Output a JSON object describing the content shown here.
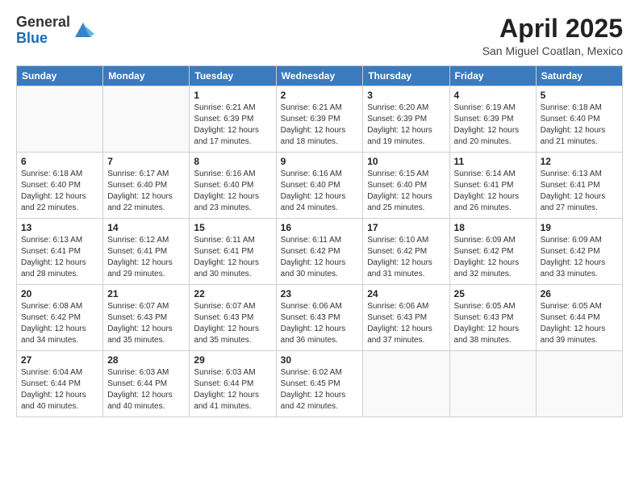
{
  "logo": {
    "general": "General",
    "blue": "Blue"
  },
  "title": "April 2025",
  "location": "San Miguel Coatlan, Mexico",
  "days_of_week": [
    "Sunday",
    "Monday",
    "Tuesday",
    "Wednesday",
    "Thursday",
    "Friday",
    "Saturday"
  ],
  "weeks": [
    [
      {
        "day": "",
        "info": ""
      },
      {
        "day": "",
        "info": ""
      },
      {
        "day": "1",
        "info": "Sunrise: 6:21 AM\nSunset: 6:39 PM\nDaylight: 12 hours and 17 minutes."
      },
      {
        "day": "2",
        "info": "Sunrise: 6:21 AM\nSunset: 6:39 PM\nDaylight: 12 hours and 18 minutes."
      },
      {
        "day": "3",
        "info": "Sunrise: 6:20 AM\nSunset: 6:39 PM\nDaylight: 12 hours and 19 minutes."
      },
      {
        "day": "4",
        "info": "Sunrise: 6:19 AM\nSunset: 6:39 PM\nDaylight: 12 hours and 20 minutes."
      },
      {
        "day": "5",
        "info": "Sunrise: 6:18 AM\nSunset: 6:40 PM\nDaylight: 12 hours and 21 minutes."
      }
    ],
    [
      {
        "day": "6",
        "info": "Sunrise: 6:18 AM\nSunset: 6:40 PM\nDaylight: 12 hours and 22 minutes."
      },
      {
        "day": "7",
        "info": "Sunrise: 6:17 AM\nSunset: 6:40 PM\nDaylight: 12 hours and 22 minutes."
      },
      {
        "day": "8",
        "info": "Sunrise: 6:16 AM\nSunset: 6:40 PM\nDaylight: 12 hours and 23 minutes."
      },
      {
        "day": "9",
        "info": "Sunrise: 6:16 AM\nSunset: 6:40 PM\nDaylight: 12 hours and 24 minutes."
      },
      {
        "day": "10",
        "info": "Sunrise: 6:15 AM\nSunset: 6:40 PM\nDaylight: 12 hours and 25 minutes."
      },
      {
        "day": "11",
        "info": "Sunrise: 6:14 AM\nSunset: 6:41 PM\nDaylight: 12 hours and 26 minutes."
      },
      {
        "day": "12",
        "info": "Sunrise: 6:13 AM\nSunset: 6:41 PM\nDaylight: 12 hours and 27 minutes."
      }
    ],
    [
      {
        "day": "13",
        "info": "Sunrise: 6:13 AM\nSunset: 6:41 PM\nDaylight: 12 hours and 28 minutes."
      },
      {
        "day": "14",
        "info": "Sunrise: 6:12 AM\nSunset: 6:41 PM\nDaylight: 12 hours and 29 minutes."
      },
      {
        "day": "15",
        "info": "Sunrise: 6:11 AM\nSunset: 6:41 PM\nDaylight: 12 hours and 30 minutes."
      },
      {
        "day": "16",
        "info": "Sunrise: 6:11 AM\nSunset: 6:42 PM\nDaylight: 12 hours and 30 minutes."
      },
      {
        "day": "17",
        "info": "Sunrise: 6:10 AM\nSunset: 6:42 PM\nDaylight: 12 hours and 31 minutes."
      },
      {
        "day": "18",
        "info": "Sunrise: 6:09 AM\nSunset: 6:42 PM\nDaylight: 12 hours and 32 minutes."
      },
      {
        "day": "19",
        "info": "Sunrise: 6:09 AM\nSunset: 6:42 PM\nDaylight: 12 hours and 33 minutes."
      }
    ],
    [
      {
        "day": "20",
        "info": "Sunrise: 6:08 AM\nSunset: 6:42 PM\nDaylight: 12 hours and 34 minutes."
      },
      {
        "day": "21",
        "info": "Sunrise: 6:07 AM\nSunset: 6:43 PM\nDaylight: 12 hours and 35 minutes."
      },
      {
        "day": "22",
        "info": "Sunrise: 6:07 AM\nSunset: 6:43 PM\nDaylight: 12 hours and 35 minutes."
      },
      {
        "day": "23",
        "info": "Sunrise: 6:06 AM\nSunset: 6:43 PM\nDaylight: 12 hours and 36 minutes."
      },
      {
        "day": "24",
        "info": "Sunrise: 6:06 AM\nSunset: 6:43 PM\nDaylight: 12 hours and 37 minutes."
      },
      {
        "day": "25",
        "info": "Sunrise: 6:05 AM\nSunset: 6:43 PM\nDaylight: 12 hours and 38 minutes."
      },
      {
        "day": "26",
        "info": "Sunrise: 6:05 AM\nSunset: 6:44 PM\nDaylight: 12 hours and 39 minutes."
      }
    ],
    [
      {
        "day": "27",
        "info": "Sunrise: 6:04 AM\nSunset: 6:44 PM\nDaylight: 12 hours and 40 minutes."
      },
      {
        "day": "28",
        "info": "Sunrise: 6:03 AM\nSunset: 6:44 PM\nDaylight: 12 hours and 40 minutes."
      },
      {
        "day": "29",
        "info": "Sunrise: 6:03 AM\nSunset: 6:44 PM\nDaylight: 12 hours and 41 minutes."
      },
      {
        "day": "30",
        "info": "Sunrise: 6:02 AM\nSunset: 6:45 PM\nDaylight: 12 hours and 42 minutes."
      },
      {
        "day": "",
        "info": ""
      },
      {
        "day": "",
        "info": ""
      },
      {
        "day": "",
        "info": ""
      }
    ]
  ]
}
